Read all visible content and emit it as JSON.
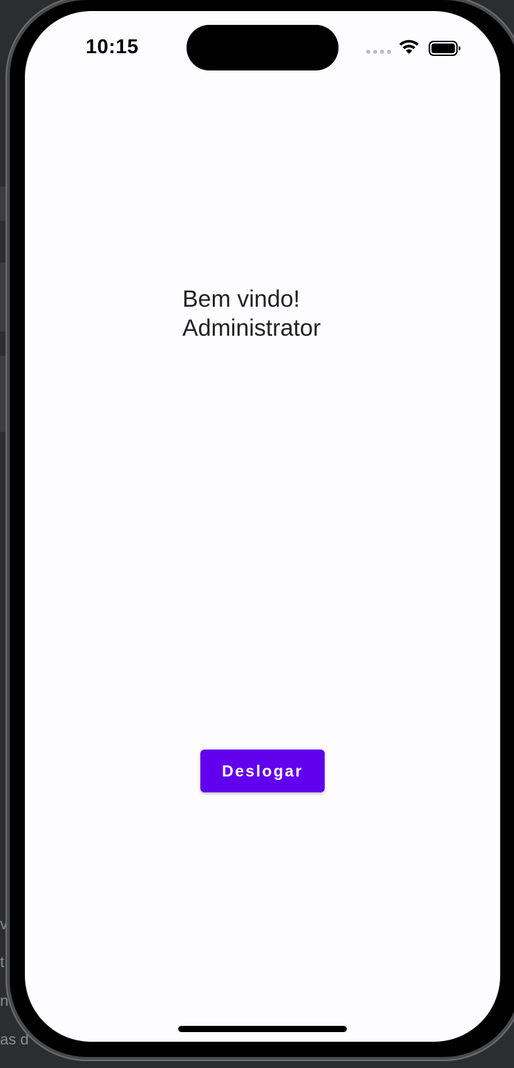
{
  "status_bar": {
    "time": "10:15",
    "wifi_icon": "wifi-icon",
    "battery_icon": "battery-icon"
  },
  "content": {
    "welcome_line": "Bem vindo!",
    "user_name": "Administrator"
  },
  "actions": {
    "logout_label": "Deslogar"
  },
  "background_fragments": [
    "v",
    "t",
    "n",
    "as d"
  ],
  "colors": {
    "accent": "#6200ee",
    "screen_bg": "#fdfcff",
    "text": "#222222"
  }
}
